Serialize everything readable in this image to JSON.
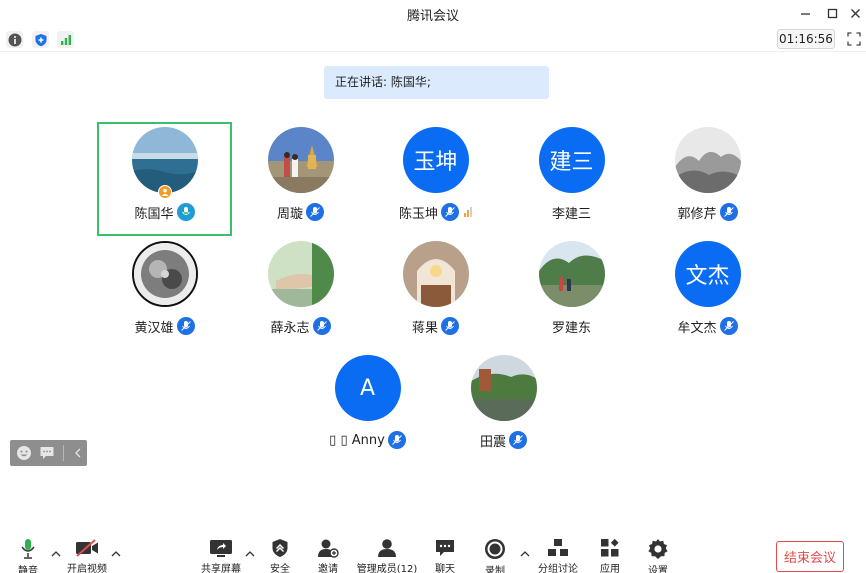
{
  "window": {
    "title": "腾讯会议"
  },
  "infobar": {
    "timer": "01:16:56"
  },
  "speaking": {
    "text": "正在讲话: 陈国华;"
  },
  "participants": [
    {
      "name": "陈国华",
      "avatar_text": "",
      "active": true,
      "host": true
    },
    {
      "name": "周璇",
      "avatar_text": ""
    },
    {
      "name": "陈玉坤",
      "avatar_text": "玉坤"
    },
    {
      "name": "李建三",
      "avatar_text": "建三"
    },
    {
      "name": "郭修芹",
      "avatar_text": ""
    },
    {
      "name": "黄汉雄",
      "avatar_text": ""
    },
    {
      "name": "薛永志",
      "avatar_text": ""
    },
    {
      "name": "蒋果",
      "avatar_text": ""
    },
    {
      "name": "罗建东",
      "avatar_text": ""
    },
    {
      "name": "牟文杰",
      "avatar_text": "文杰"
    },
    {
      "name": "▯ ▯ Anny",
      "avatar_text": "A"
    },
    {
      "name": "田震",
      "avatar_text": ""
    }
  ],
  "toolbar": {
    "mute": "静音",
    "video": "开启视频",
    "share": "共享屏幕",
    "security": "安全",
    "invite": "邀请",
    "members": "管理成员(12)",
    "chat": "聊天",
    "record": "录制",
    "breakout": "分组讨论",
    "apps": "应用",
    "settings": "设置",
    "end": "结束会议"
  },
  "colors": {
    "accent": "#0a6cf2",
    "active_border": "#3cbf6a",
    "end": "#e54b4b",
    "banner": "#dbeafd"
  }
}
